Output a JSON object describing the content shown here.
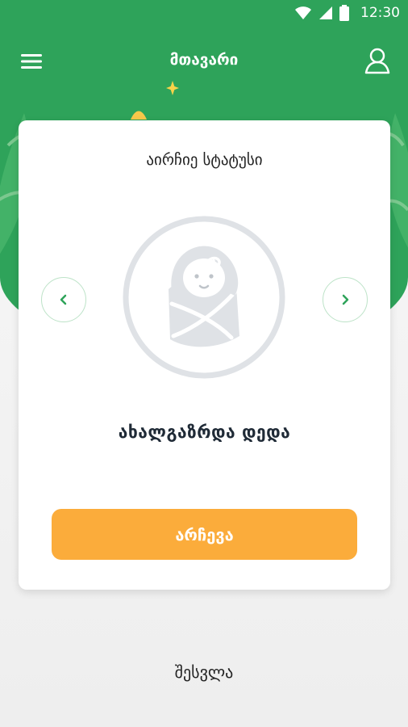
{
  "statusbar": {
    "time": "12:30"
  },
  "appbar": {
    "title": "მთავარი"
  },
  "card": {
    "title": "აირჩიე სტატუსი",
    "status_name": "ახალგაზრდა დედა",
    "choose_label": "არჩევა"
  },
  "footer": {
    "login_label": "შესვლა"
  },
  "colors": {
    "brand_green": "#2ea35a",
    "accent_orange": "#fbac3b",
    "icon_gray": "#dfe2e6"
  },
  "icons": {
    "menu": "menu-icon",
    "profile": "user-icon",
    "prev": "chevron-left-icon",
    "next": "chevron-right-icon",
    "avatar": "baby-icon"
  }
}
